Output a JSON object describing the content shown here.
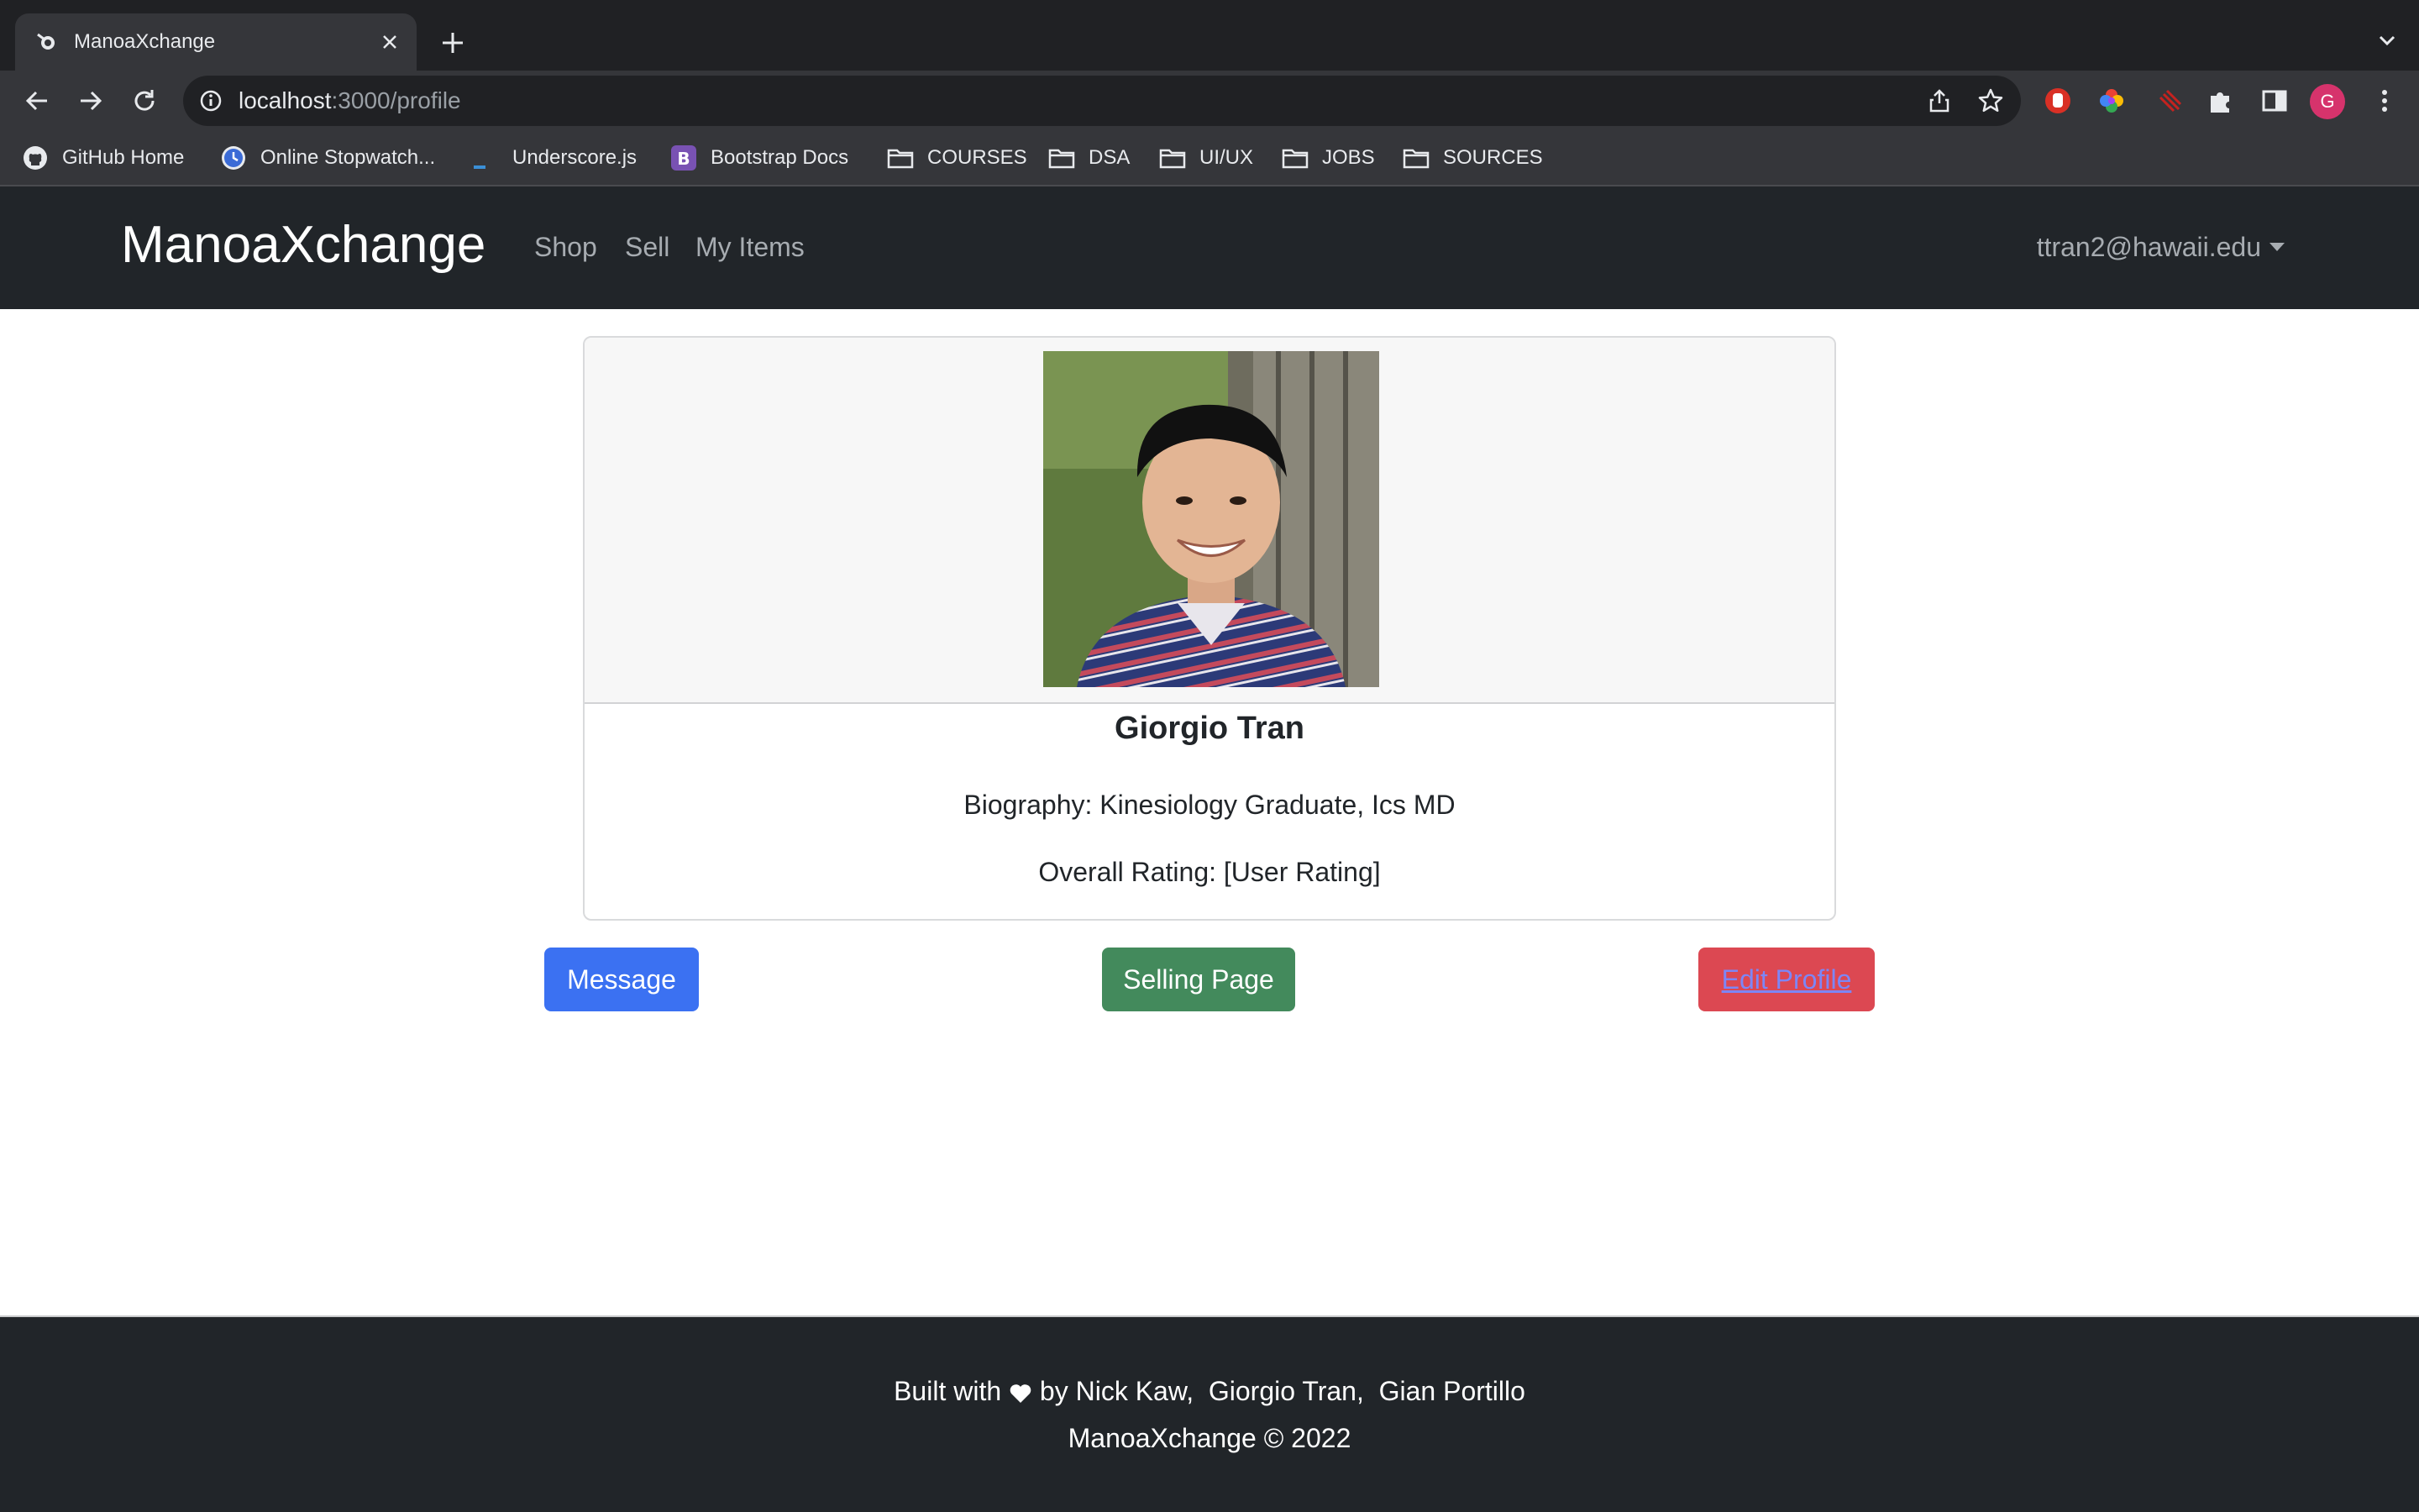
{
  "browser": {
    "tab_title": "ManoaXchange",
    "url_host": "localhost",
    "url_rest": ":3000/profile",
    "profile_initial": "G",
    "bookmarks": [
      {
        "label": "GitHub Home",
        "icon": "github-icon"
      },
      {
        "label": "Online Stopwatch...",
        "icon": "clock-icon"
      },
      {
        "label": "Underscore.js",
        "icon": "underscore-icon"
      },
      {
        "label": "Bootstrap Docs",
        "icon": "bootstrap-icon"
      },
      {
        "label": "COURSES",
        "icon": "folder-icon"
      },
      {
        "label": "DSA",
        "icon": "folder-icon"
      },
      {
        "label": "UI/UX",
        "icon": "folder-icon"
      },
      {
        "label": "JOBS",
        "icon": "folder-icon"
      },
      {
        "label": "SOURCES",
        "icon": "folder-icon"
      }
    ]
  },
  "navbar": {
    "brand": "ManoaXchange",
    "links": [
      "Shop",
      "Sell",
      "My Items"
    ],
    "user": "ttran2@hawaii.edu"
  },
  "profile": {
    "name": "Giorgio Tran",
    "biography": "Biography: Kinesiology Graduate, Ics MD",
    "rating": "Overall Rating: [User Rating]"
  },
  "actions": {
    "message": "Message",
    "selling_page": "Selling Page",
    "edit_profile": "Edit Profile"
  },
  "footer": {
    "line1_prefix": "Built with",
    "line1_suffix": "by Nick Kaw,  Giorgio Tran,  Gian Portillo",
    "line2": "ManoaXchange © 2022"
  },
  "colors": {
    "navbar_bg": "#212529",
    "message_button": "#3b71f2",
    "selling_button": "#438a5c",
    "edit_button": "#dc4852"
  }
}
